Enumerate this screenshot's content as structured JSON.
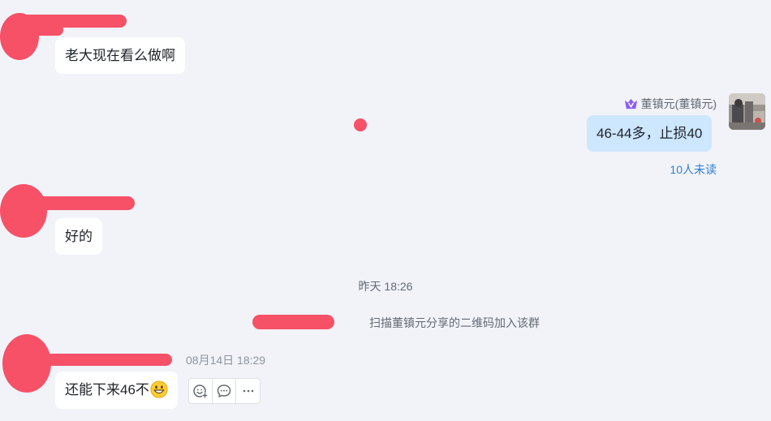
{
  "messages": [
    {
      "text": "老大现在看么做啊"
    },
    {
      "text": "好的"
    },
    {
      "text": "还能下来46不"
    }
  ],
  "my_message": {
    "sender": "董镇元(董镇元)",
    "text": "46-44多，止损40",
    "read_status": "10人未读"
  },
  "system": {
    "time_divider": "昨天 18:26",
    "join_notice": "扫描董镇元分享的二维码加入该群"
  },
  "last_message_timestamp": "08月14日 18:29",
  "icons": {
    "badge": "verified-v-crown-icon",
    "emoji": "grinning-face-emoji",
    "reaction": "add-reaction-icon",
    "reply": "reply-bubble-icon",
    "more": "more-icon"
  },
  "colors": {
    "background": "#f1f3f9",
    "my_bubble": "#cce7ff",
    "redaction": "#f65167",
    "read_status": "#2b7fd0"
  }
}
